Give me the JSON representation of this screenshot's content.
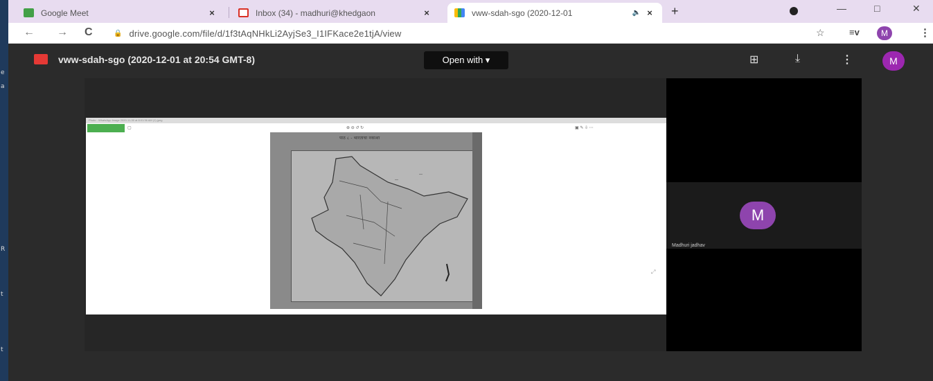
{
  "desktop": {
    "side_letters": [
      "e",
      "a",
      "R",
      "t",
      "t"
    ]
  },
  "tabs": [
    {
      "title": "Google Meet",
      "icon": "meet-icon",
      "close": "×"
    },
    {
      "title": "Inbox (34) - madhuri@khedgaon",
      "icon": "gmail-icon",
      "close": "×"
    },
    {
      "title": "vww-sdah-sgo (2020-12-01",
      "icon": "drive-icon",
      "audio": "🔈",
      "close": "×"
    }
  ],
  "window": {
    "new_tab": "+",
    "minimize": "—",
    "maximize": "□",
    "close": "✕"
  },
  "address": {
    "back": "←",
    "forward": "→",
    "reload": "C",
    "lock": "🔒",
    "url": "drive.google.com/file/d/1f3tAqNHkLi2AyjSe3_I1IFKace2e1tjA/view",
    "star": "☆",
    "media": "≡v",
    "avatar": "M",
    "menu": "⋮"
  },
  "viewer": {
    "file_title": "vww-sdah-sgo (2020-12-01 at 20:54 GMT-8)",
    "open_with": "Open with ▾",
    "icons": {
      "present": "⊞",
      "download": "⤓",
      "more": "⋮"
    },
    "avatar": "M"
  },
  "shared_screen": {
    "header_text": "Photo - WhatsApp Image 2020-11-30 at 8:01:36 AM (1).jpeg",
    "page_caption": "पाठ ८ - भारताचा नकाशा"
  },
  "participant": {
    "avatar": "M",
    "name": "Madhuri jadhav"
  },
  "colors": {
    "tab_bar": "#e8dcf0",
    "viewer_bg": "#2b2b2b",
    "avatar": "#8e44ad",
    "file_icon": "#e53935",
    "meet_green": "#4caf50"
  }
}
